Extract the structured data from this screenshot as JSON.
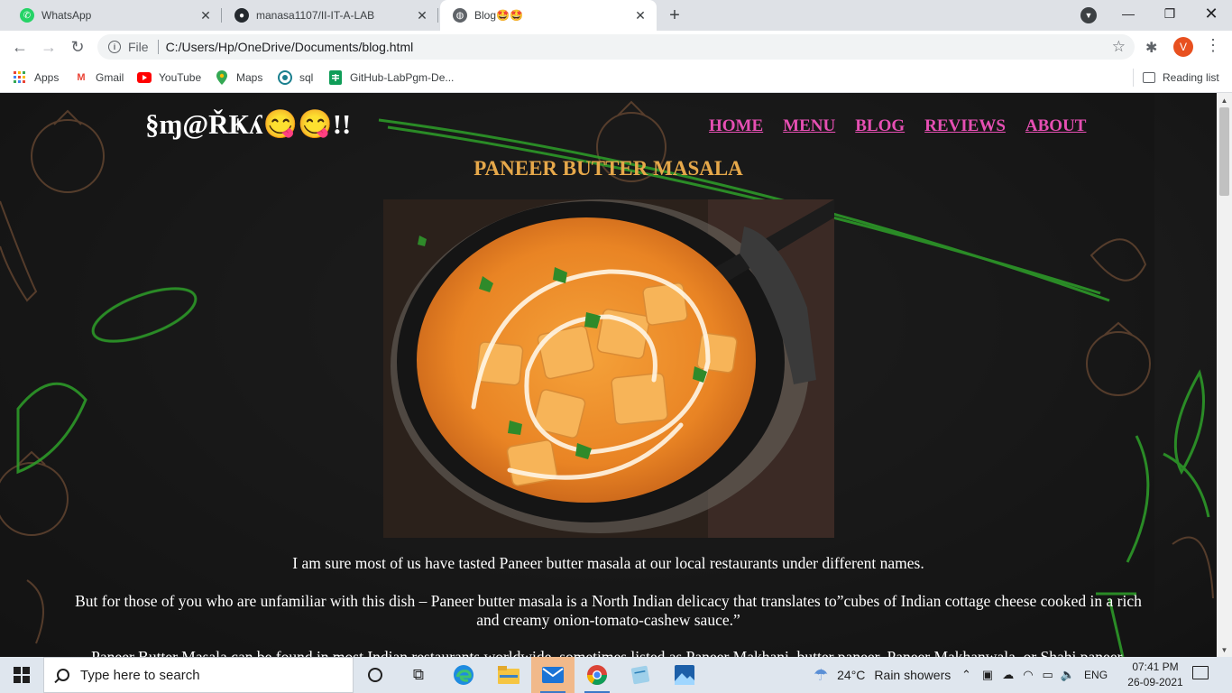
{
  "browser": {
    "tabs": [
      {
        "title": "WhatsApp",
        "icon": "whatsapp-icon",
        "active": false
      },
      {
        "title": "manasa1107/II-IT-A-LAB",
        "icon": "github-icon",
        "active": false
      },
      {
        "title": "Blog🤩🤩",
        "icon": "globe-icon",
        "active": true
      }
    ],
    "address": {
      "scheme_label": "File",
      "url": "C:/Users/Hp/OneDrive/Documents/blog.html"
    },
    "profile_initial": "V",
    "bookmarks": [
      {
        "label": "Apps",
        "icon": "apps-grid-icon"
      },
      {
        "label": "Gmail",
        "icon": "gmail-icon"
      },
      {
        "label": "YouTube",
        "icon": "youtube-icon"
      },
      {
        "label": "Maps",
        "icon": "maps-icon"
      },
      {
        "label": "sql",
        "icon": "sql-icon"
      },
      {
        "label": "GitHub-LabPgm-De...",
        "icon": "sheets-icon"
      }
    ],
    "reading_list_label": "Reading list"
  },
  "page": {
    "logo": "§ɱ@ŘҜʎ😋😋!!",
    "nav": [
      "HOME",
      "MENU",
      "BLOG",
      "REVIEWS",
      "ABOUT"
    ],
    "dish_title": "PANEER BUTTER MASALA",
    "paragraphs": [
      "I am sure most of us have tasted Paneer butter masala at our local restaurants under different names.",
      "But for those of you who are unfamiliar with this dish – Paneer butter masala is a North Indian delicacy that translates to”cubes of Indian cottage cheese cooked in a rich and creamy onion-tomato-cashew sauce.”",
      "Paneer Butter Masala can be found in most Indian restaurants worldwide, sometimes listed as Paneer Makhani, butter paneer, Paneer Makhanwala, or Shahi paneer."
    ],
    "colors": {
      "nav_link": "#e64fb3",
      "dish_title": "#e6a84a",
      "body_text": "#ffffff",
      "background": "#1b1b1b"
    }
  },
  "taskbar": {
    "search_placeholder": "Type here to search",
    "weather": {
      "temp": "24°C",
      "condition": "Rain showers"
    },
    "language": "ENG",
    "time": "07:41 PM",
    "date": "26-09-2021",
    "apps": [
      "task-view-icon",
      "edge-icon",
      "file-explorer-icon",
      "mail-icon",
      "chrome-icon",
      "notepad-icon",
      "photos-icon"
    ]
  }
}
